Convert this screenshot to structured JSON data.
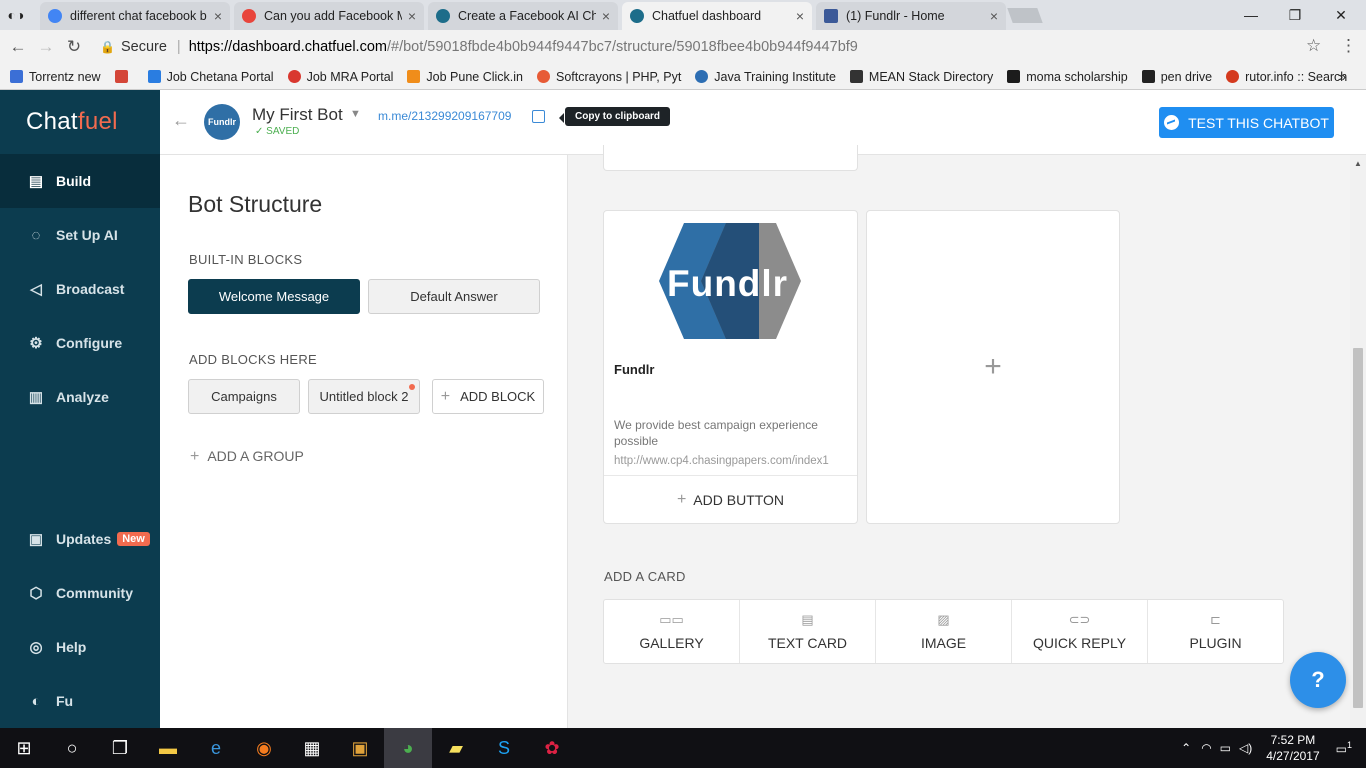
{
  "browser": {
    "tabs": [
      {
        "title": "different chat facebook b",
        "favicon_color": "#4285f4"
      },
      {
        "title": "Can you add Facebook M",
        "favicon_color": "#e8453c"
      },
      {
        "title": "Create a Facebook AI Ch",
        "favicon_color": "#1d6d8a"
      },
      {
        "title": "Chatfuel dashboard",
        "favicon_color": "#1d6d8a"
      },
      {
        "title": "(1) Fundlr - Home",
        "favicon_color": "#3b5998"
      }
    ],
    "security_label": "Secure",
    "url_host": "https://dashboard.chatfuel.com",
    "url_path": "/#/bot/59018fbde4b0b944f9447bc7/structure/59018fbee4b0b944f9447bf9",
    "bookmarks": [
      "Torrentz new",
      "",
      "Job Chetana Portal",
      "Job MRA Portal",
      "Job Pune Click.in",
      "Softcrayons | PHP, Pyt",
      "Java Training Institute",
      "MEAN Stack Directory",
      "moma scholarship",
      "pen drive",
      "rutor.info :: Search"
    ]
  },
  "sidebar": {
    "logo_a": "Chat",
    "logo_b": "fuel",
    "items": [
      {
        "label": "Build",
        "icon": "build-icon"
      },
      {
        "label": "Set Up AI",
        "icon": "ai-icon"
      },
      {
        "label": "Broadcast",
        "icon": "megaphone-icon"
      },
      {
        "label": "Configure",
        "icon": "gear-icon"
      },
      {
        "label": "Analyze",
        "icon": "chart-icon"
      },
      {
        "label": "Updates",
        "icon": "updates-icon",
        "badge": "New"
      },
      {
        "label": "Community",
        "icon": "community-icon"
      },
      {
        "label": "Help",
        "icon": "help-icon"
      },
      {
        "label": "Fu",
        "icon": "avatar-icon"
      }
    ]
  },
  "header": {
    "avatar_text": "Fundlr",
    "bot_name": "My First Bot",
    "saved": "SAVED",
    "link": "m.me/213299209167709",
    "tooltip": "Copy to clipboard",
    "test_button": "TEST THIS CHATBOT"
  },
  "structure": {
    "title": "Bot Structure",
    "builtin_label": "BUILT-IN BLOCKS",
    "builtin": [
      "Welcome Message",
      "Default Answer"
    ],
    "add_label": "ADD BLOCKS HERE",
    "blocks": [
      "Campaigns",
      "Untitled block 2"
    ],
    "add_block": "ADD BLOCK",
    "add_group": "ADD A GROUP"
  },
  "card": {
    "logo_text": "Fundlr",
    "title": "Fundlr",
    "description": "We provide best campaign experience possible",
    "url": "http://www.cp4.chasingpapers.com/index1",
    "add_button": "ADD BUTTON"
  },
  "add_card": {
    "label": "ADD A CARD",
    "types": [
      "GALLERY",
      "TEXT CARD",
      "IMAGE",
      "QUICK REPLY",
      "PLUGIN"
    ]
  },
  "taskbar": {
    "time": "7:52 PM",
    "date": "4/27/2017",
    "notifications": "1"
  }
}
